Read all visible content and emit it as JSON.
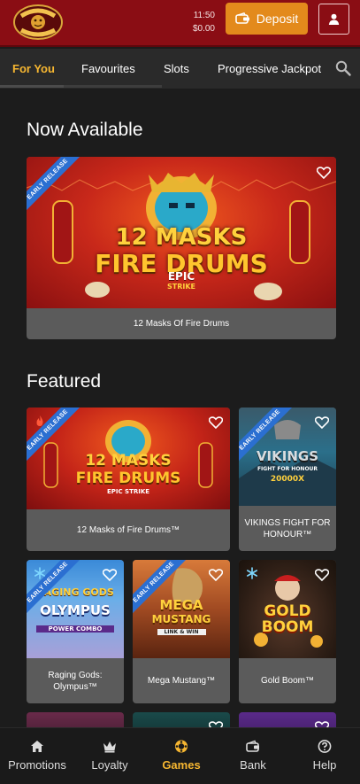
{
  "header": {
    "logo_text": "GOLDEN TIGER",
    "time": "11:50",
    "balance": "$0.00",
    "deposit_label": "Deposit"
  },
  "tabs": [
    "For You",
    "Favourites",
    "Slots",
    "Progressive Jackpot"
  ],
  "sections": {
    "now_available": "Now Available",
    "featured": "Featured"
  },
  "ribbon_text": "EARLY RELEASE",
  "now_available": {
    "title": "12 Masks Of Fire Drums",
    "art": {
      "line1": "12 MASKS",
      "of": "OF",
      "line2": "FIRE DRUMS",
      "line3": "EPIC",
      "line4": "STRIKE"
    }
  },
  "featured": [
    {
      "title": "12 Masks of Fire Drums™",
      "art_l1": "12 MASKS",
      "art_l2": "FIRE DRUMS",
      "art_l3": "EPIC STRIKE"
    },
    {
      "title": "VIKINGS FIGHT FOR HONOUR™",
      "art_l1": "VIKINGS",
      "art_l2": "FIGHT FOR HONOUR",
      "art_l3": "20000X"
    },
    {
      "title": "Raging Gods: Olympus™",
      "art_l1": "RAGING GODS",
      "art_l2": "OLYMPUS",
      "art_l3": "POWER COMBO"
    },
    {
      "title": "Mega Mustang™",
      "art_l1": "MEGA",
      "art_l2": "MUSTANG",
      "art_l3": "LINK & WIN"
    },
    {
      "title": "Gold Boom™",
      "art_l1": "GOLD",
      "art_l2": "BOOM",
      "art_l3": ""
    }
  ],
  "bottom_nav": [
    "Promotions",
    "Loyalty",
    "Games",
    "Bank",
    "Help"
  ],
  "colors": {
    "header_red": "#8a0d14",
    "deposit_orange": "#e38a1c",
    "active_gold": "#f7b731",
    "ribbon_blue": "#2b6fd1",
    "caption_gray": "#5b5b5b"
  }
}
